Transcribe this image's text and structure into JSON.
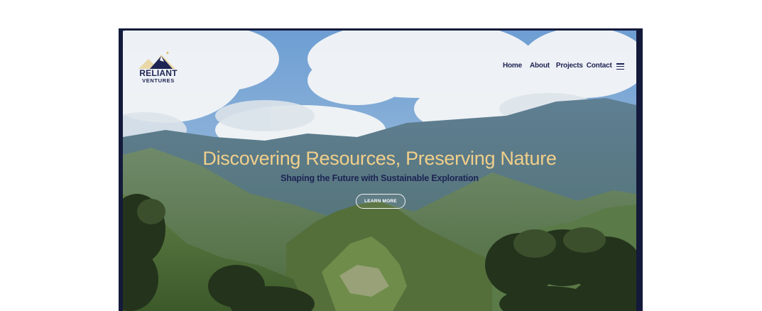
{
  "brand": {
    "name_line1": "RELIANT",
    "name_line2": "VENTURES",
    "logo_icon": "mountain-star-logo",
    "color": "#1d2453"
  },
  "nav": {
    "items": [
      {
        "label": "Home"
      },
      {
        "label": "About"
      },
      {
        "label": "Projects"
      },
      {
        "label": "Contact"
      }
    ],
    "menu_icon": "hamburger-menu-icon"
  },
  "hero": {
    "headline": "Discovering Resources, Preserving Nature",
    "subheadline": "Shaping the Future with Sustainable Exploration",
    "cta_label": "LEARN MORE",
    "headline_color": "#f1cf8a",
    "frame_color": "#141a3a"
  }
}
